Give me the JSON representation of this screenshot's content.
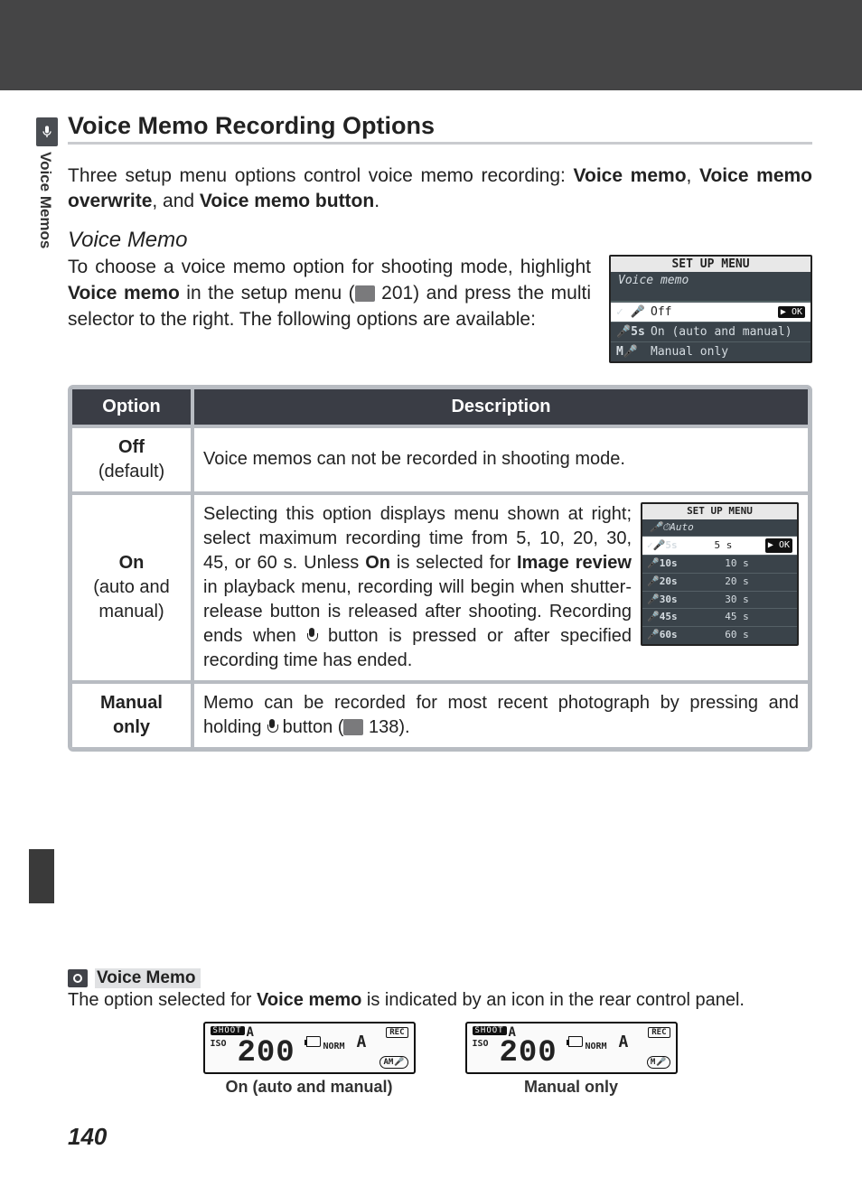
{
  "side": {
    "section": "Voice Memos"
  },
  "h1": "Voice Memo Recording Options",
  "intro": {
    "pre": "Three setup menu options control voice memo recording: ",
    "b1": "Voice memo",
    "mid1": ", ",
    "b2": "Voice memo overwrite",
    "mid2": ", and ",
    "b3": "Voice memo button",
    "post": "."
  },
  "subhead": "Voice Memo",
  "lead": {
    "t1": "To choose a voice memo option for shooting mode, highlight ",
    "b1": "Voice memo",
    "t2": " in the setup menu (",
    "ref": " 201) and press the multi selector to the right. The following options are available:"
  },
  "menu1": {
    "title": "SET UP MENU",
    "crumb": "Voice memo",
    "rows": [
      {
        "ic": "✓ 🎤",
        "txt": "Off",
        "ok": "▶ OK",
        "sel": true
      },
      {
        "ic": "🎤5s",
        "txt": "On (auto and manual)"
      },
      {
        "ic": "M🎤",
        "txt": "Manual only"
      }
    ]
  },
  "table": {
    "head": {
      "opt": "Option",
      "desc": "Description"
    },
    "rows": [
      {
        "opt": "Off",
        "sub": "(default)",
        "desc": "Voice memos can not be recorded in shooting mode."
      },
      {
        "opt": "On",
        "sub": "(auto and manual)",
        "desc_parts": {
          "t1": "Selecting this option displays menu shown at right; select maximum recording time from 5, 10, 20, 30, 45, or 60 s.  Unless ",
          "b1": "On",
          "t2": " is selected for ",
          "b2": "Image review",
          "t3": " in playback menu, recording will begin when shutter-release button is released after shooting.  Recording ends when ",
          "t4": " button is pressed or after specified recording time has ended."
        },
        "submenu": {
          "title": "SET UP MENU",
          "crumb": "Auto",
          "rows": [
            {
              "ic": "✓🎤5s",
              "txt": "5 s",
              "ok": "▶ OK",
              "sel": true
            },
            {
              "ic": "🎤10s",
              "txt": "10 s"
            },
            {
              "ic": "🎤20s",
              "txt": "20 s"
            },
            {
              "ic": "🎤30s",
              "txt": "30 s"
            },
            {
              "ic": "🎤45s",
              "txt": "45 s"
            },
            {
              "ic": "🎤60s",
              "txt": "60 s"
            }
          ]
        }
      },
      {
        "opt": "Manual only",
        "desc_parts": {
          "t1": "Memo can be recorded for most recent photograph by pressing and holding ",
          "t2": " button (",
          "ref": " 138)."
        }
      }
    ]
  },
  "note": {
    "title": "Voice Memo",
    "text_pre": "The option selected for ",
    "text_b": "Voice memo",
    "text_post": " is indicated by an icon in the rear control panel."
  },
  "panels": {
    "shoot": "SHOOT",
    "iso": "ISO",
    "a": "A",
    "num": "200",
    "norm": "NORM",
    "rec": "REC",
    "am": "AM",
    "m": "M",
    "cap1": "On (auto and manual)",
    "cap2": "Manual only"
  },
  "page_number": "140"
}
